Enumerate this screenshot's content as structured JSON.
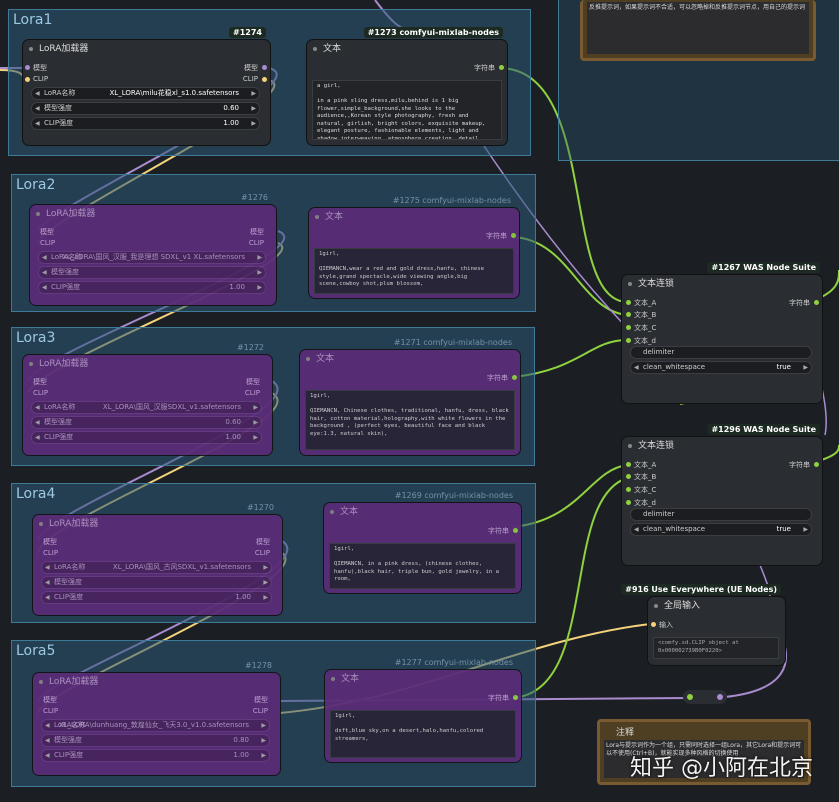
{
  "groups": [
    {
      "title": "Lora1"
    },
    {
      "title": "Lora2"
    },
    {
      "title": "Lora3"
    },
    {
      "title": "Lora4"
    },
    {
      "title": "Lora5"
    }
  ],
  "lora_nodes": [
    {
      "id": "#1274",
      "title": "LoRA加载器",
      "in_model": "模型",
      "in_clip": "CLIP",
      "out_model": "模型",
      "out_clip": "CLIP",
      "name_label": "LoRA名称",
      "name_value": "XL_LORA\\milu花稳xl_s1.0.safetensors",
      "model_label": "模型强度",
      "model_value": "0.60",
      "clip_label": "CLIP强度",
      "clip_value": "1.00"
    },
    {
      "id": "#1276",
      "title": "LoRA加载器",
      "in_model": "模型",
      "in_clip": "CLIP",
      "out_model": "模型",
      "out_clip": "CLIP",
      "name_label": "LoRA名称",
      "name_value": "XL_LORA\\国风_汉服_我是理想 SDXL_v1 XL.safetensors",
      "model_label": "模型强度",
      "model_value": "",
      "clip_label": "CLIP强度",
      "clip_value": "1.00"
    },
    {
      "id": "#1272",
      "title": "LoRA加载器",
      "in_model": "模型",
      "in_clip": "CLIP",
      "out_model": "模型",
      "out_clip": "CLIP",
      "name_label": "LoRA名称",
      "name_value": "XL_LORA\\国风_汉服SDXL_v1.safetensors",
      "model_label": "模型强度",
      "model_value": "0.60",
      "clip_label": "CLIP强度",
      "clip_value": "1.00"
    },
    {
      "id": "#1270",
      "title": "LoRA加载器",
      "in_model": "模型",
      "in_clip": "CLIP",
      "out_model": "模型",
      "out_clip": "CLIP",
      "name_label": "LoRA名称",
      "name_value": "XL_LORA\\国风_古风SDXL_v1.safetensors",
      "model_label": "模型强度",
      "model_value": "",
      "clip_label": "CLIP强度",
      "clip_value": "1.00"
    },
    {
      "id": "#1278",
      "title": "LoRA加载器",
      "in_model": "模型",
      "in_clip": "CLIP",
      "out_model": "模型",
      "out_clip": "CLIP",
      "name_label": "LoRA名称",
      "name_value": "XL_LORA\\dunhuang_敦煌仙女_飞天3.0_v1.0.safetensors",
      "model_label": "模型强度",
      "model_value": "0.80",
      "clip_label": "CLIP强度",
      "clip_value": "1.00"
    }
  ],
  "text_nodes": [
    {
      "id": "#1273 comfyui-mixlab-nodes",
      "title": "文本",
      "out": "字符串",
      "text": "a girl,\n\nin a pink sling dress,milu,behind is 1 big flower,simple_background,she looks to the audience,,Korean style photography, fresh and natural, girlish, bright colors, exquisite makeup, elegant posture, fashionable elements, light and shadow interweaving, atmosphere creation, detail processing, visual appeal"
    },
    {
      "id": "#1275 comfyui-mixlab-nodes",
      "title": "文本",
      "out": "字符串",
      "text": "1girl,\n\nQIEMANCN,wear a red and gold dress,hanfu, chinese style,grand spectacle,wide viewing angle,big scene,cowboy shot,plum blossom,"
    },
    {
      "id": "#1271 comfyui-mixlab-nodes",
      "title": "文本",
      "out": "字符串",
      "text": "1girl,\n\nQIEMANCN, Chinese clothes, traditional, hanfu, dress, black hair, cotton material,holography,with white flowers in the background , (perfect eyes, beautiful face and black eye:1.3, natural skin),"
    },
    {
      "id": "#1269 comfyui-mixlab-nodes",
      "title": "文本",
      "out": "字符串",
      "text": "1girl,\n\nQIEMANCN, in a pink dress, (chinese clothes, hanfu),black hair, triple bun, gold jewelry, in a room,"
    },
    {
      "id": "#1277 comfyui-mixlab-nodes",
      "title": "文本",
      "out": "字符串",
      "text": "1girl,\n\ndsft,blue sky,on a desert,halo,hanfu,colored streamers,"
    }
  ],
  "concat_nodes": [
    {
      "id": "#1267 WAS Node Suite",
      "title": "文本连锁",
      "a": "文本_A",
      "b": "文本_B",
      "c": "文本_C",
      "d": "文本_d",
      "out": "字符串",
      "delimiter": "delimiter",
      "cw_label": "clean_whitespace",
      "cw_value": "true"
    },
    {
      "id": "#1296 WAS Node Suite",
      "title": "文本连锁",
      "a": "文本_A",
      "b": "文本_B",
      "c": "文本_C",
      "d": "文本_d",
      "out": "字符串",
      "delimiter": "delimiter",
      "cw_label": "clean_whitespace",
      "cw_value": "true"
    }
  ],
  "ue_node": {
    "id": "#916 Use Everywhere (UE Nodes)",
    "title": "全局输入",
    "input": "输入",
    "text": "<comfy.sd.CLIP object at 0x000002739B0F0220>"
  },
  "top_note": {
    "text": "反推提示词，如果提示词不合适，可以忽略掉和反推提示词节点，用自己的提示词"
  },
  "bottom_note": {
    "title": "注释",
    "text": "Lora与提示词作为一个组，只需同时选择一组Lora，其它Lora和提示词可以不使用(Ctrl+B)，就能实现多种风格的切换使用"
  },
  "watermark": "知乎 @小阿在北京",
  "colors": {
    "clip_wire": "#f3d27a",
    "model_wire": "#a98cd0",
    "string_wire": "#8fd13f",
    "group_border": "#3e7a98"
  }
}
